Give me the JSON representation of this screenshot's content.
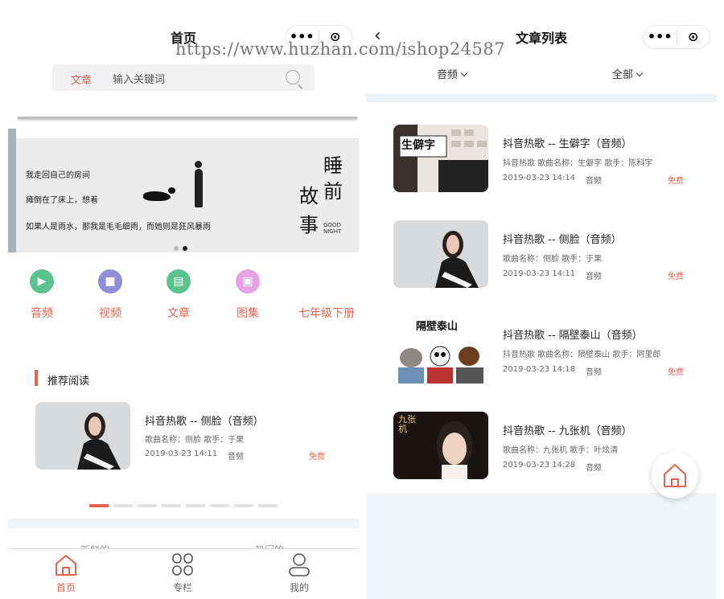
{
  "watermark": "https://www.huzhan.com/ishop24587",
  "home": {
    "title": "首页",
    "capsule": {
      "more": "•••",
      "close": "⊙"
    },
    "search": {
      "category": "文章",
      "placeholder": "输入关键词"
    },
    "banner": {
      "lines": [
        "我走回自己的房间",
        "瘫倒在了床上，想着",
        "如果人是雨水，那我是毛毛细雨，而她则是狂风暴雨"
      ],
      "big_text": [
        "睡",
        "前",
        "故",
        "事"
      ],
      "small_text": "GOOD NIGHT"
    },
    "grid": [
      {
        "label": "音频",
        "icon": "play-icon",
        "color": "#5cc28f"
      },
      {
        "label": "视频",
        "icon": "video-icon",
        "color": "#8f8fd8"
      },
      {
        "label": "文章",
        "icon": "document-icon",
        "color": "#5cc28f"
      },
      {
        "label": "图集",
        "icon": "image-icon",
        "color": "#e6a3e6"
      },
      {
        "label": "七年级下册",
        "icon": "",
        "color": ""
      }
    ],
    "section_title": "推荐阅读",
    "recommended": {
      "title": "抖音热歌 -- 侧脸（音频）",
      "meta": "歌曲名称：侧脸 歌手：于果",
      "date": "2019-03-23 14:11",
      "type": "音频",
      "price": "免费"
    },
    "bottom_tabs_hidden": [
      "新鲜的",
      "热门的"
    ],
    "tabbar": [
      {
        "label": "首页",
        "icon": "home-icon"
      },
      {
        "label": "专栏",
        "icon": "grid-icon"
      },
      {
        "label": "我的",
        "icon": "user-icon"
      }
    ]
  },
  "list": {
    "title": "文章列表",
    "back": "‹",
    "capsule": {
      "more": "•••",
      "close": "⊙"
    },
    "filters": [
      {
        "label": "音频"
      },
      {
        "label": "全部"
      }
    ],
    "articles": [
      {
        "title": "抖音热歌 -- 生僻字（音频）",
        "meta": "抖音热歌 歌曲名称：生僻字 歌手：陈科宇",
        "date": "2019-03-23 14:14",
        "type": "音频",
        "price": "免费",
        "thumb_text": "生僻字"
      },
      {
        "title": "抖音热歌 -- 侧脸（音频）",
        "meta": "歌曲名称：侧脸 歌手：于果",
        "date": "2019-03-23 14:11",
        "type": "音频",
        "price": "免费",
        "thumb_text": ""
      },
      {
        "title": "抖音热歌 -- 隔壁泰山（音频）",
        "meta": "抖音热歌 歌曲名称：隔壁泰山 歌手：阿里郎",
        "date": "2019-03-23 14:18",
        "type": "音频",
        "price": "免费",
        "thumb_text": "隔壁泰山"
      },
      {
        "title": "抖音热歌 -- 九张机（音频）",
        "meta": "歌曲名称：九张机 歌手：叶炫清",
        "date": "2019-03-23 14:28",
        "type": "音频",
        "price": "",
        "thumb_text": "九张机"
      }
    ]
  }
}
